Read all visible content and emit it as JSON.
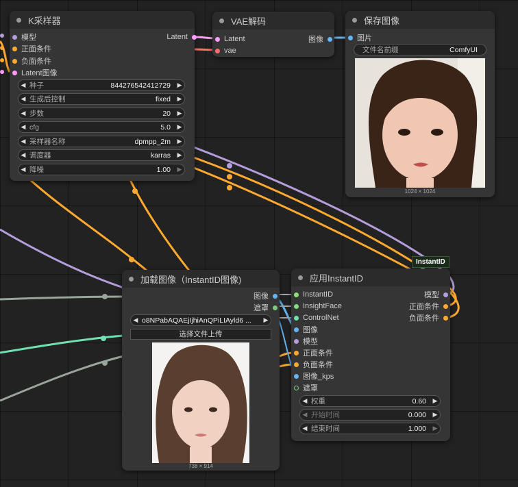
{
  "colors": {
    "model": "#b39ddb",
    "conditioning": "#ffa931",
    "latent": "#ff9cf9",
    "vae": "#ff6e6e",
    "image": "#64b5f6",
    "instantid": "#8ce07a",
    "insightface": "#80e080",
    "controlnet": "#70e0b0",
    "mask": "#81c784",
    "gray": "#9aa59a"
  },
  "ksampler": {
    "title": "K采样器",
    "inputs": [
      "模型",
      "正面条件",
      "负面条件",
      "Latent图像"
    ],
    "output": "Latent",
    "widgets": [
      {
        "label": "种子",
        "value": "844276542412729"
      },
      {
        "label": "生成后控制",
        "value": "fixed"
      },
      {
        "label": "步数",
        "value": "20"
      },
      {
        "label": "cfg",
        "value": "5.0"
      },
      {
        "label": "采样器名称",
        "value": "dpmpp_2m"
      },
      {
        "label": "调度器",
        "value": "karras"
      },
      {
        "label": "降噪",
        "value": "1.00"
      }
    ]
  },
  "vae_decode": {
    "title": "VAE解码",
    "inputs": [
      "Latent",
      "vae"
    ],
    "output": "图像"
  },
  "save_image": {
    "title": "保存图像",
    "input": "图片",
    "prefix_label": "文件名前缀",
    "prefix_value": "ComfyUI",
    "image_size": "1024 × 1024"
  },
  "load_image": {
    "title": "加载图像（InstantID图像)",
    "outputs": [
      "图像",
      "遮罩"
    ],
    "file_value": "o8NPabAQAEjIjhiAnQPiLIAyld6 ...",
    "upload_label": "选择文件上传",
    "image_size": "738 × 914"
  },
  "apply_instantid": {
    "title": "应用InstantID",
    "badge": "InstantID",
    "inputs": [
      "InstantID",
      "InsightFace",
      "ControlNet",
      "图像",
      "模型",
      "正面条件",
      "负面条件",
      "图像_kps",
      "遮罩"
    ],
    "outputs": [
      "模型",
      "正面条件",
      "负面条件"
    ],
    "widgets": [
      {
        "label": "权重",
        "value": "0.60"
      },
      {
        "label": "开始时间",
        "value": "0.000"
      },
      {
        "label": "结束时间",
        "value": "1.000"
      }
    ]
  }
}
